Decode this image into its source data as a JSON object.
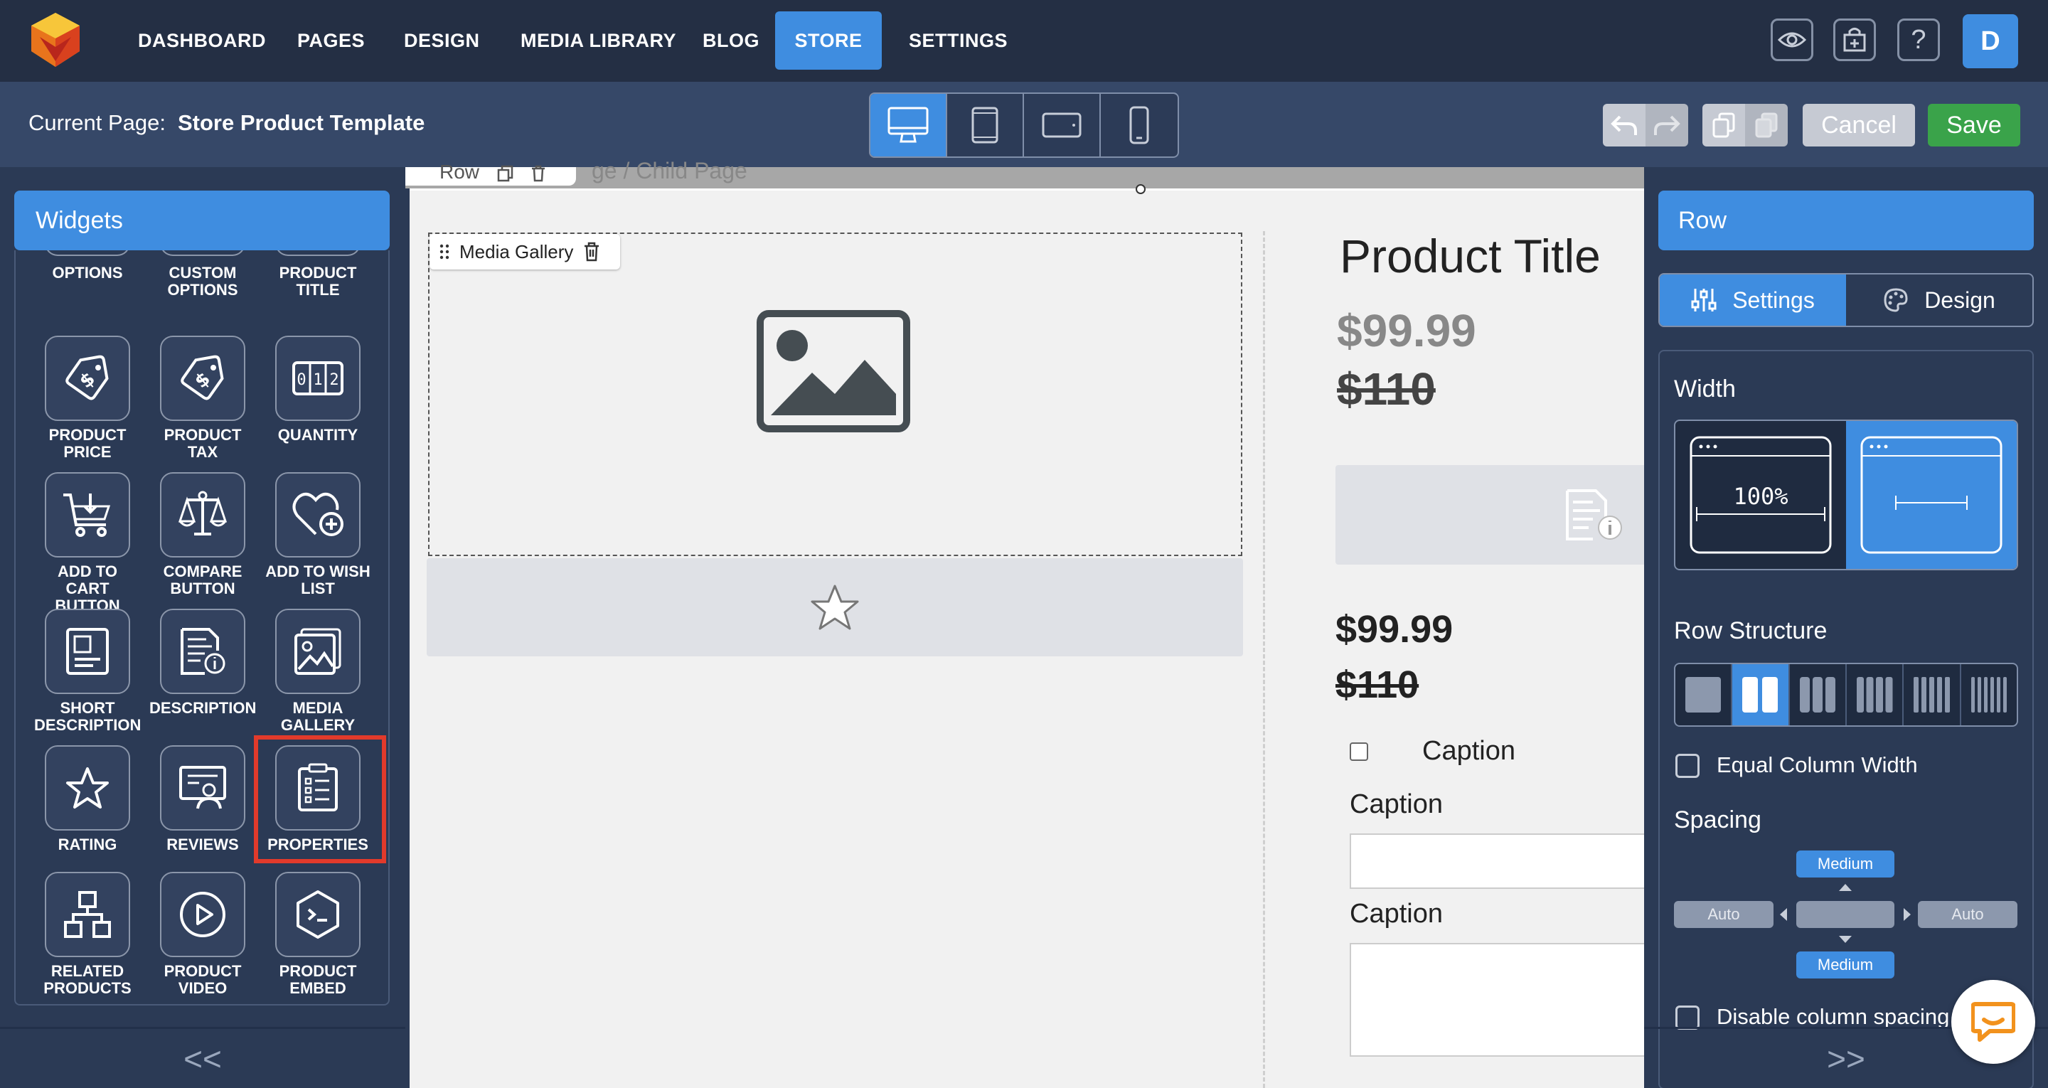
{
  "nav": {
    "items": [
      "DASHBOARD",
      "PAGES",
      "DESIGN",
      "MEDIA LIBRARY",
      "BLOG",
      "STORE",
      "SETTINGS"
    ],
    "active": "STORE",
    "avatar_letter": "D",
    "help_label": "?"
  },
  "subbar": {
    "current_label": "Current Page:",
    "current_value": "Store Product Template",
    "cancel_label": "Cancel",
    "save_label": "Save"
  },
  "widgets": {
    "header": "Widgets",
    "partial_row": [
      "OPTIONS",
      "CUSTOM OPTIONS",
      "PRODUCT TITLE"
    ],
    "items": [
      {
        "label": "PRODUCT PRICE",
        "icon": "price-tag-icon"
      },
      {
        "label": "PRODUCT TAX",
        "icon": "tax-tag-icon"
      },
      {
        "label": "QUANTITY",
        "icon": "quantity-icon"
      },
      {
        "label": "ADD TO CART BUTTON",
        "icon": "cart-icon"
      },
      {
        "label": "COMPARE BUTTON",
        "icon": "scale-icon"
      },
      {
        "label": "ADD TO WISH LIST",
        "icon": "heart-plus-icon"
      },
      {
        "label": "SHORT DESCRIPTION",
        "icon": "short-description-icon"
      },
      {
        "label": "DESCRIPTION",
        "icon": "description-icon"
      },
      {
        "label": "MEDIA GALLERY",
        "icon": "gallery-icon"
      },
      {
        "label": "RATING",
        "icon": "star-icon"
      },
      {
        "label": "REVIEWS",
        "icon": "reviews-icon"
      },
      {
        "label": "PROPERTIES",
        "icon": "properties-icon"
      },
      {
        "label": "RELATED PRODUCTS",
        "icon": "related-icon"
      },
      {
        "label": "PRODUCT VIDEO",
        "icon": "video-icon"
      },
      {
        "label": "PRODUCT EMBED",
        "icon": "embed-icon"
      }
    ],
    "highlighted": "PROPERTIES",
    "collapse_label": "<<"
  },
  "canvas": {
    "row_tag": "Row",
    "breadcrumb_ghost": "ge  /  Child Page",
    "media_gallery_tag": "Media Gallery",
    "product_title": "Product Title",
    "price": "$99.99",
    "old_price": "$110",
    "price2": "$99.99",
    "old_price2": "$110",
    "caption_checkbox": "Caption",
    "caption_text": "Caption",
    "caption_textarea": "Caption"
  },
  "right": {
    "header": "Row",
    "tab_settings": "Settings",
    "tab_design": "Design",
    "width_label": "Width",
    "width_full_text": "100%",
    "row_structure_label": "Row Structure",
    "equal_column_label": "Equal Column Width",
    "spacing_label": "Spacing",
    "spacing_top": "Medium",
    "spacing_left": "Auto",
    "spacing_right": "Auto",
    "spacing_bottom": "Medium",
    "disable_spacing_label": "Disable column spacing",
    "collapse_label": ">>"
  },
  "colors": {
    "accent": "#3f8de0",
    "save": "#3aa34a",
    "highlight": "#e23a2b",
    "nav_bg": "#242f44",
    "panel_bg": "#2b3a55"
  }
}
